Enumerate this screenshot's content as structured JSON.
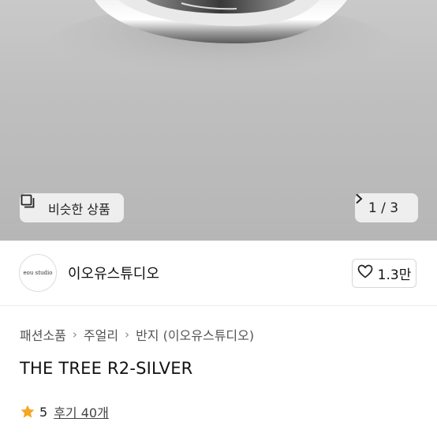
{
  "gallery": {
    "similar_label": "비슷한 상품",
    "page_current": "1",
    "page_separator": "/",
    "page_total": "3"
  },
  "seller": {
    "avatar_text": "eou studio",
    "name": "이오유스튜디오",
    "likes": "1.3만"
  },
  "breadcrumb": [
    "패션소품",
    "주얼리",
    "반지 (이오유스튜디오)"
  ],
  "product": {
    "title": "THE TREE R2-SILVER",
    "rating": "5",
    "reviews": "후기 40개"
  },
  "colors": {
    "star": "#f5a623"
  }
}
